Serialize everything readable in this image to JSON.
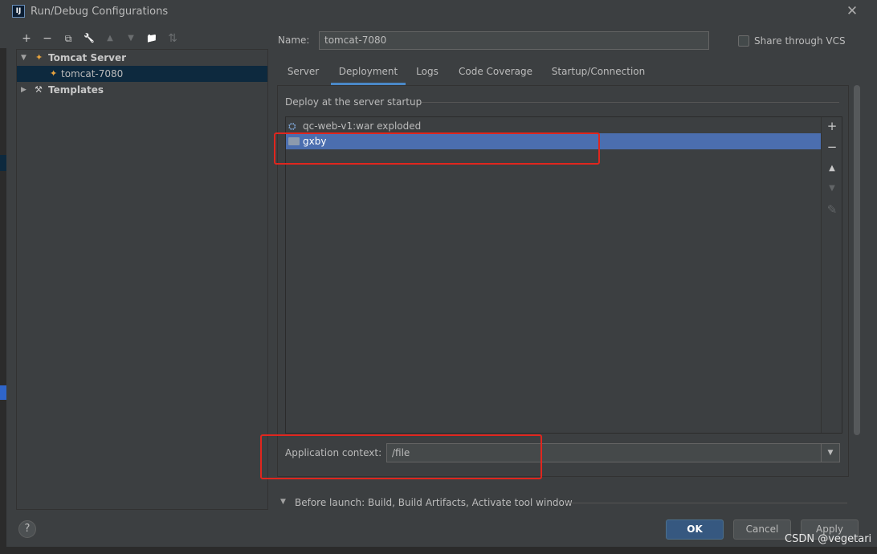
{
  "window": {
    "title": "Run/Debug Configurations",
    "app_icon_text": "IJ",
    "close_glyph": "✕"
  },
  "toolbar": {
    "add": "+",
    "remove": "−",
    "copy": "⧉",
    "edit": "🔧",
    "up": "▲",
    "down": "▼",
    "folder": "📁",
    "sort": "⇅"
  },
  "tree": {
    "items": [
      {
        "label": "Tomcat Server",
        "icon": "tomcat-icon",
        "expanded": true
      },
      {
        "label": "tomcat-7080",
        "icon": "tomcat-icon",
        "selected": true
      },
      {
        "label": "Templates",
        "icon": "wrench-icon",
        "expanded": false
      }
    ],
    "caret_down": "▼",
    "caret_right": "▶"
  },
  "name_field": {
    "label": "Name:",
    "value": "tomcat-7080"
  },
  "share": {
    "label": "Share through VCS",
    "checked": false
  },
  "tabs": [
    {
      "label": "Server"
    },
    {
      "label": "Deployment",
      "active": true
    },
    {
      "label": "Logs"
    },
    {
      "label": "Code Coverage"
    },
    {
      "label": "Startup/Connection"
    }
  ],
  "deployment": {
    "section_title": "Deploy at the server startup",
    "items": [
      {
        "label": "qc-web-v1:war exploded",
        "icon": "artifact-icon"
      },
      {
        "label": "gxby",
        "icon": "folder-icon",
        "selected": true
      }
    ],
    "side_buttons": {
      "add": "+",
      "remove": "−",
      "up": "▲",
      "down": "▼",
      "edit": "✎"
    },
    "app_context_label": "Application context:",
    "app_context_value": "/file",
    "dropdown_glyph": "▼"
  },
  "before_launch": {
    "caret": "▼",
    "text": "Before launch: Build, Build Artifacts, Activate tool window"
  },
  "buttons": {
    "help": "?",
    "ok": "OK",
    "cancel": "Cancel",
    "apply": "Apply"
  },
  "watermark": "CSDN @vegetari",
  "colors": {
    "background": "#3c3f41",
    "selection": "#4b6eaf",
    "tree_selection": "#0d293e",
    "annotation_red": "#e0261e",
    "ok_button": "#365880",
    "tab_underline": "#4a88c7"
  }
}
